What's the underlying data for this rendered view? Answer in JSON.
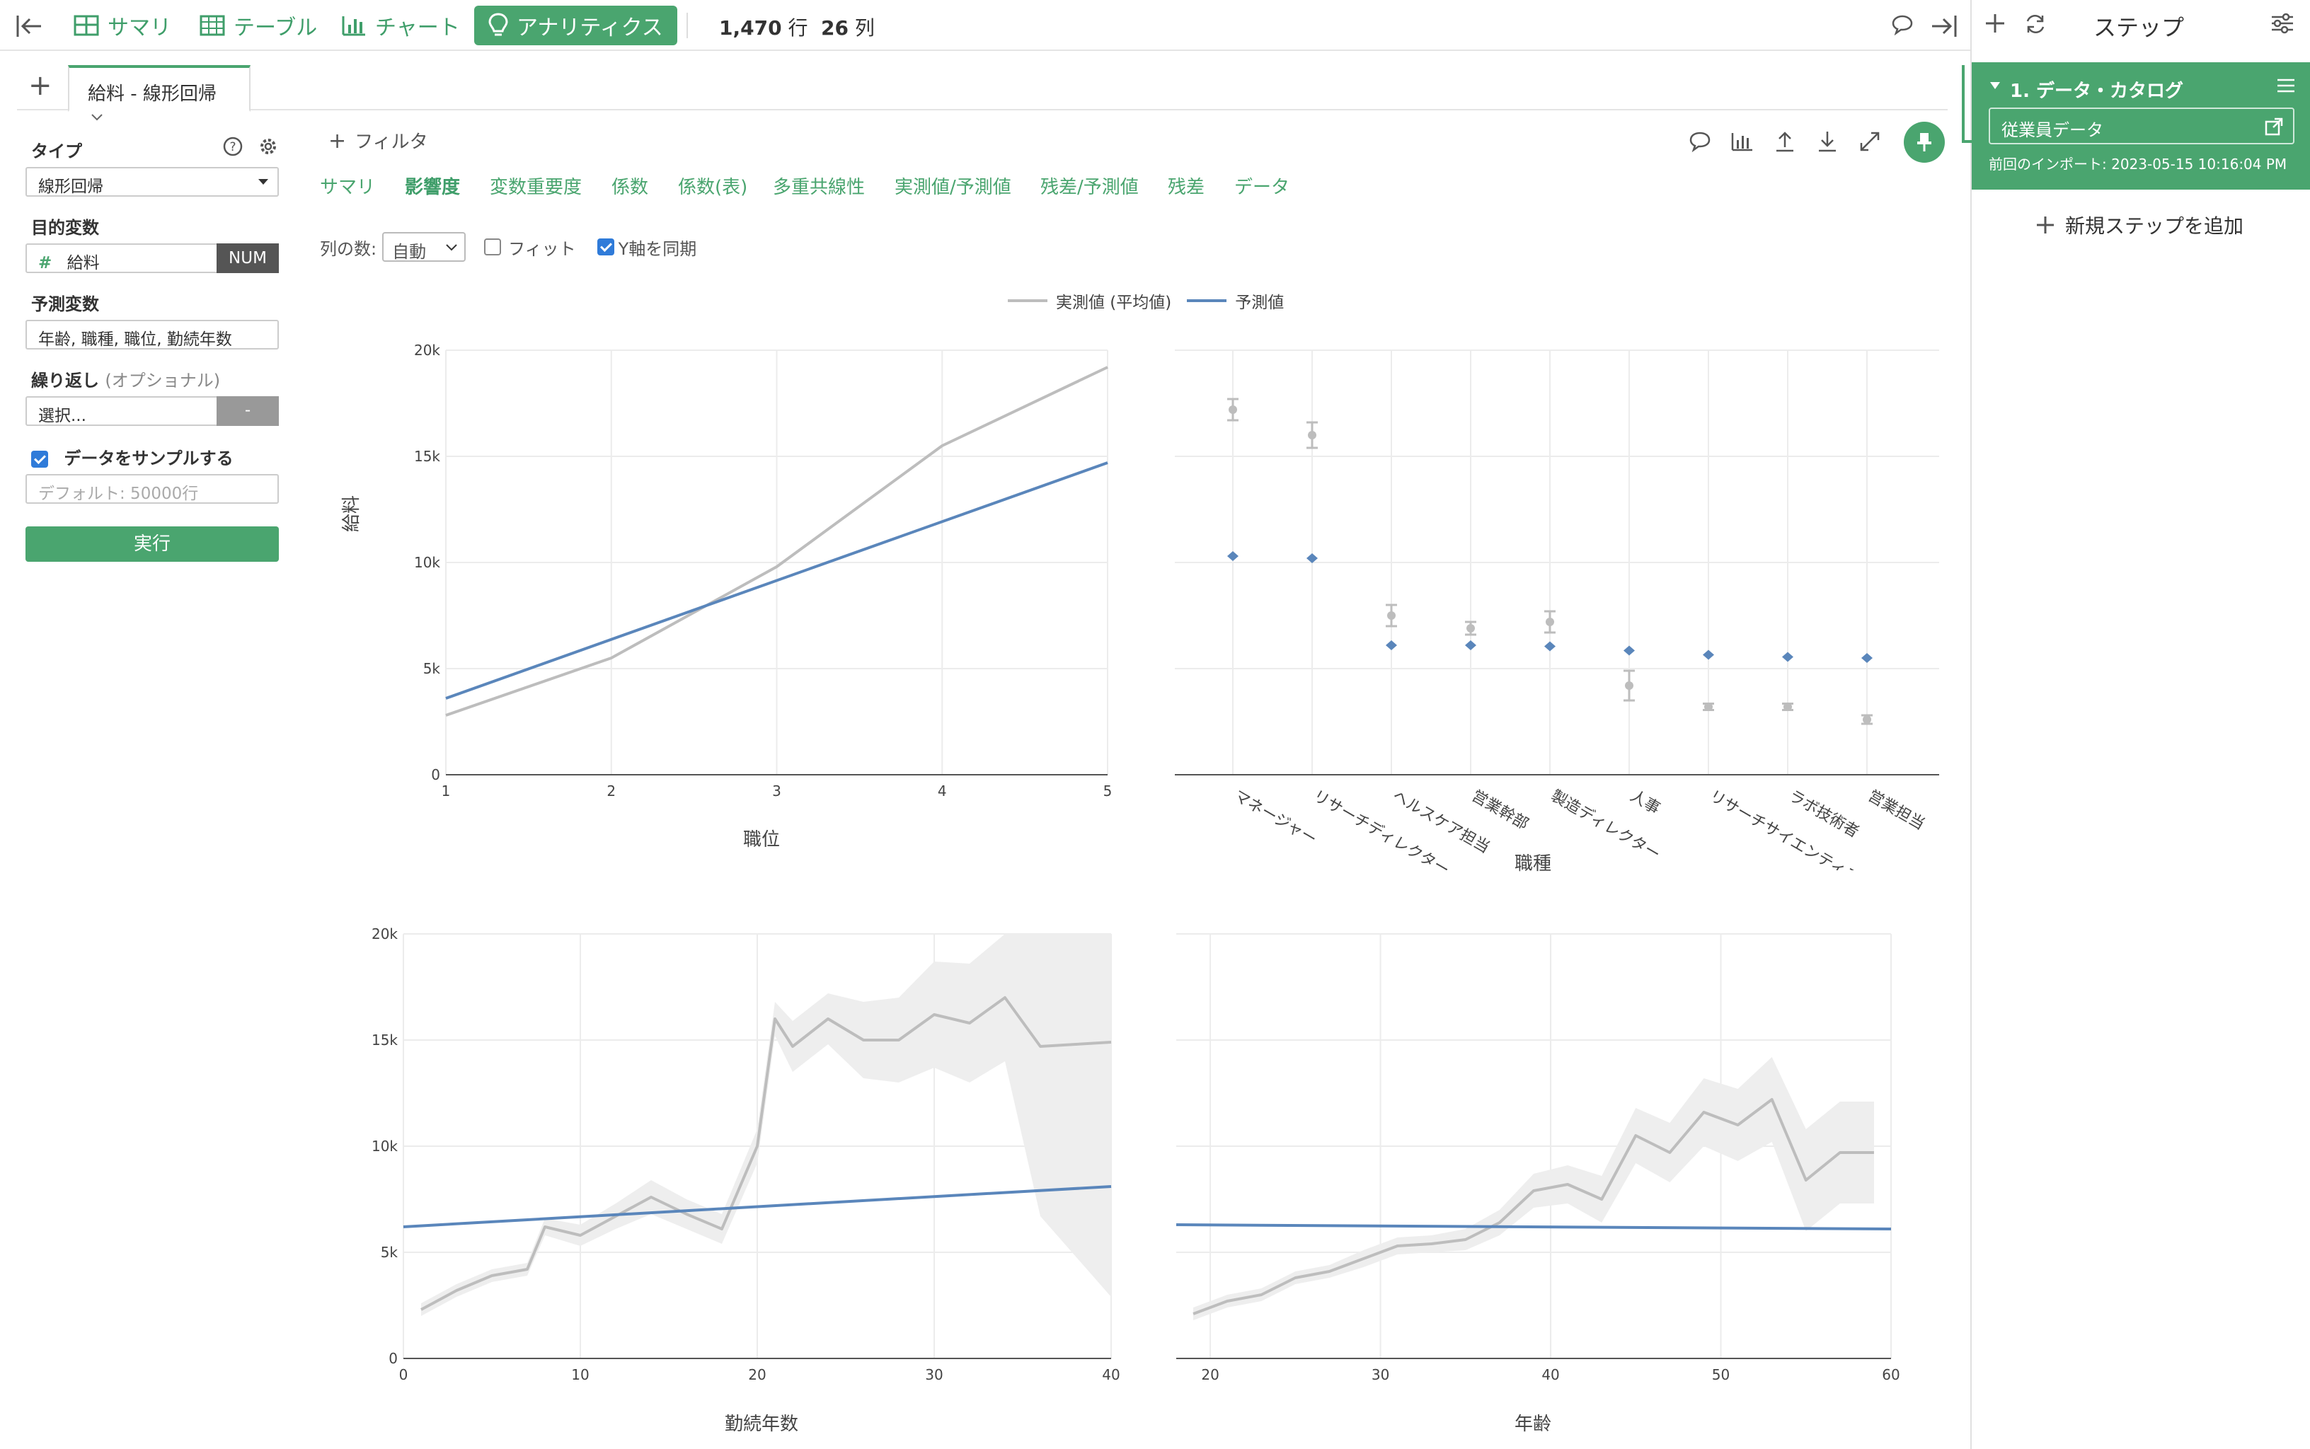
{
  "topbar": {
    "nav": [
      {
        "label": "サマリ",
        "icon": "summary-icon"
      },
      {
        "label": "テーブル",
        "icon": "table-icon"
      },
      {
        "label": "チャート",
        "icon": "chart-icon"
      },
      {
        "label": "アナリティクス",
        "icon": "lightbulb-icon",
        "active": true
      }
    ],
    "rows_value": "1,470",
    "rows_unit": "行",
    "cols_value": "26",
    "cols_unit": "列"
  },
  "tab": {
    "label": "給料 - 線形回帰"
  },
  "settings": {
    "type_label": "タイプ",
    "type_value": "線形回帰",
    "target_label": "目的変数",
    "target_value": "給料",
    "target_badge": "NUM",
    "predictor_label": "予測変数",
    "predictor_value": "年齢, 職種, 職位, 勤続年数",
    "repeat_label": "繰り返し",
    "repeat_optional": "(オプショナル)",
    "repeat_placeholder": "選択...",
    "repeat_badge": "-",
    "sample_label": "データをサンプルする",
    "sample_placeholder": "デフォルト: 50000行",
    "run_label": "実行"
  },
  "main": {
    "filter_label": "フィルタ",
    "subtabs": [
      "サマリ",
      "影響度",
      "変数重要度",
      "係数",
      "係数(表)",
      "多重共線性",
      "実測値/予測値",
      "残差/予測値",
      "残差",
      "データ"
    ],
    "active_subtab": 1,
    "columns_label": "列の数:",
    "columns_value": "自動",
    "fit_label": "フィット",
    "sync_y_label": "Y軸を同期"
  },
  "right_panel": {
    "title": "ステップ",
    "step_title": "1. データ・カタログ",
    "step_source": "従業員データ",
    "step_import": "前回のインポート: 2023-05-15 10:16:04 PM",
    "add_step": "新規ステップを追加"
  },
  "colors": {
    "accent": "#4aa56f",
    "actual": "#bdbdbd",
    "predicted": "#5a86bb"
  },
  "chart_data": [
    {
      "type": "line",
      "xlabel": "職位",
      "ylabel": "給料",
      "xlim": [
        1,
        5
      ],
      "ylim": [
        0,
        20000
      ],
      "xticks": [
        1,
        2,
        3,
        4,
        5
      ],
      "yticks": [
        0,
        5000,
        10000,
        15000,
        20000
      ],
      "ytick_labels": [
        "0",
        "5k",
        "10k",
        "15k",
        "20k"
      ],
      "legend": "top-center",
      "series": [
        {
          "name": "実測値 (平均値)",
          "x": [
            1,
            2,
            3,
            4,
            5
          ],
          "y": [
            2800,
            5500,
            9800,
            15500,
            19200
          ]
        },
        {
          "name": "予測値",
          "x": [
            1,
            5
          ],
          "y": [
            3600,
            14700
          ]
        }
      ]
    },
    {
      "type": "scatter",
      "xlabel": "職種",
      "ylabel": "",
      "ylim": [
        0,
        20000
      ],
      "categories": [
        "マネージャー",
        "リサーチディレクター",
        "ヘルスケア担当",
        "営業幹部",
        "製造ディレクター",
        "人事",
        "リサーチサイエンティスト",
        "ラボ技術者",
        "営業担当"
      ],
      "actual_mean": [
        17200,
        16000,
        7500,
        6900,
        7200,
        4200,
        3200,
        3200,
        2600
      ],
      "actual_err": [
        500,
        600,
        500,
        300,
        500,
        700,
        150,
        150,
        200
      ],
      "predicted": [
        10300,
        10200,
        6100,
        6100,
        6050,
        5850,
        5650,
        5550,
        5500
      ]
    },
    {
      "type": "line",
      "xlabel": "勤続年数",
      "ylabel": "",
      "xlim": [
        0,
        40
      ],
      "ylim": [
        0,
        20000
      ],
      "xticks": [
        0,
        10,
        20,
        30,
        40
      ],
      "series": [
        {
          "name": "実測値 (平均値)",
          "x": [
            1,
            3,
            5,
            7,
            8,
            10,
            12,
            14,
            16,
            18,
            20,
            21,
            22,
            24,
            26,
            28,
            30,
            32,
            34,
            36,
            38,
            40
          ],
          "y": [
            2300,
            3200,
            3900,
            4200,
            6200,
            5800,
            6700,
            7600,
            6800,
            6100,
            10000,
            16000,
            14700,
            16000,
            15000,
            15000,
            16200,
            15800,
            17000,
            14700,
            14800,
            14900
          ],
          "band": [
            300,
            300,
            300,
            300,
            400,
            500,
            600,
            800,
            700,
            700,
            800,
            800,
            1200,
            1200,
            1800,
            2000,
            2500,
            2800,
            3000,
            8000,
            10000,
            12000
          ]
        },
        {
          "name": "予測値",
          "x": [
            0,
            40
          ],
          "y": [
            6200,
            8100
          ]
        }
      ]
    },
    {
      "type": "line",
      "xlabel": "年齢",
      "ylabel": "",
      "xlim": [
        18,
        60
      ],
      "ylim": [
        0,
        20000
      ],
      "xticks": [
        20,
        30,
        40,
        50,
        60
      ],
      "series": [
        {
          "name": "実測値 (平均値)",
          "x": [
            19,
            21,
            23,
            25,
            27,
            29,
            31,
            33,
            35,
            37,
            39,
            41,
            43,
            45,
            47,
            49,
            51,
            53,
            55,
            57,
            59
          ],
          "y": [
            2100,
            2700,
            3000,
            3800,
            4100,
            4700,
            5300,
            5400,
            5600,
            6400,
            7900,
            8200,
            7500,
            10500,
            9700,
            11600,
            11000,
            12200,
            8400,
            9700,
            9700
          ],
          "band": [
            300,
            300,
            300,
            300,
            300,
            400,
            400,
            400,
            500,
            600,
            800,
            900,
            1100,
            1300,
            1400,
            1600,
            1700,
            2000,
            2400,
            2400,
            2400
          ]
        },
        {
          "name": "予測値",
          "x": [
            18,
            60
          ],
          "y": [
            6300,
            6100
          ]
        }
      ]
    }
  ]
}
